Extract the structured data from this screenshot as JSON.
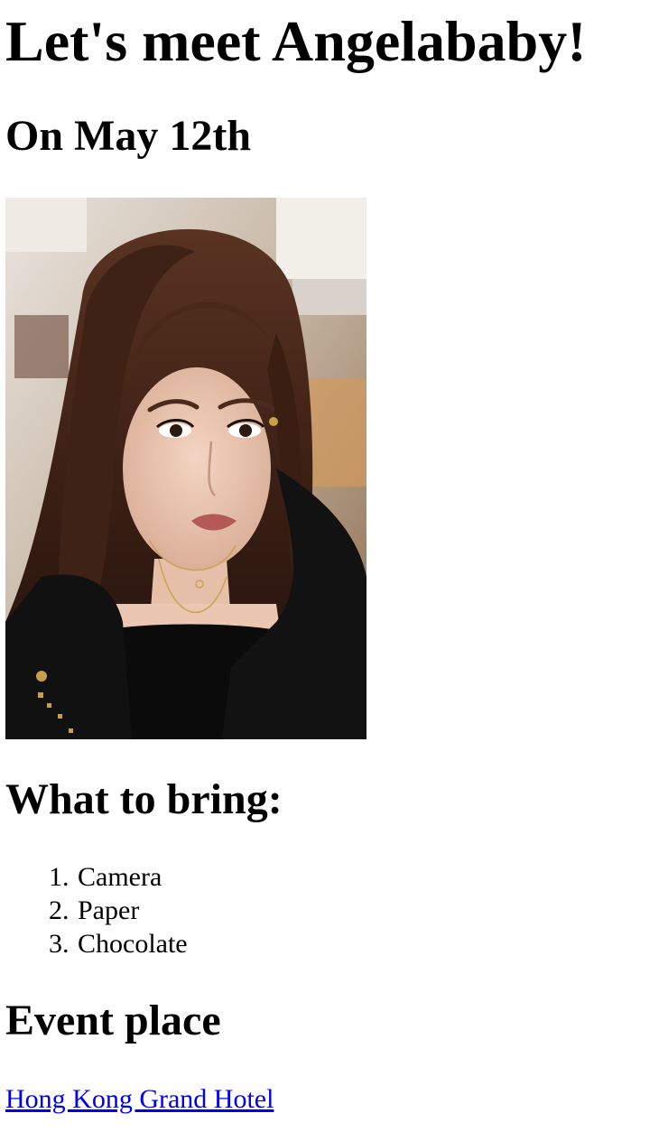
{
  "header": {
    "title": "Let's meet Angelababy!",
    "date": "On May 12th"
  },
  "photo": {
    "icon": "portrait-photo"
  },
  "bring": {
    "heading": "What to bring:",
    "items": [
      {
        "number": "1.",
        "label": "Camera"
      },
      {
        "number": "2.",
        "label": "Paper"
      },
      {
        "number": "3.",
        "label": "Chocolate"
      }
    ]
  },
  "place": {
    "heading": "Event place",
    "link_text": "Hong Kong Grand Hotel",
    "link_color": "#0000ee"
  }
}
